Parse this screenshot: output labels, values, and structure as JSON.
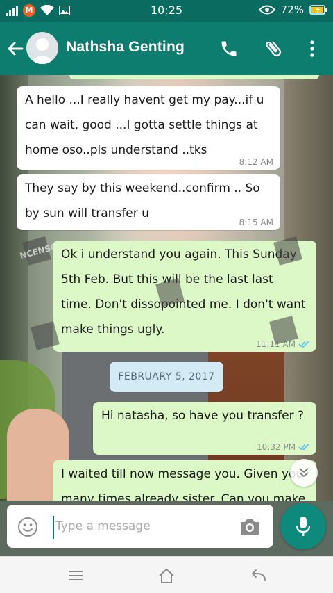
{
  "status_bar": {
    "time": "10:25",
    "battery": "72%",
    "carrier_badge": "M",
    "icons": [
      "signal-icon",
      "wifi-icon",
      "image-icon",
      "eye-icon",
      "battery-icon"
    ]
  },
  "header": {
    "contact_name": "Nathsha Genting",
    "icons": [
      "back-arrow-icon",
      "avatar-icon",
      "phone-icon",
      "paperclip-icon",
      "more-vert-icon"
    ],
    "color": "#0d7d70"
  },
  "messages": [
    {
      "direction": "in",
      "lines": [
        "A hello ...I really havent  get my pay...if u",
        "can wait, good ...I gotta settle things at",
        "home oso..pls understand ..tks"
      ],
      "time": "8:12 AM"
    },
    {
      "direction": "in",
      "lines": [
        "They say by this weekend..confirm .. So",
        "by sun will transfer u"
      ],
      "time": "8:15 AM"
    },
    {
      "direction": "out",
      "lines": [
        "Ok i understand you again. This Sunday",
        "5th Feb. But this will be the last last",
        "time. Don't dissopointed me. I don't want",
        "make things ugly."
      ],
      "time": "11:11 AM",
      "ticks": "read"
    },
    {
      "direction": "out",
      "lines": [
        "Hi natasha, so have you transfer ?"
      ],
      "time": "10:32 PM",
      "ticks": "read"
    },
    {
      "direction": "out",
      "lines": [
        "I waited till now message you. Given you",
        "many times already sister. Can you make"
      ]
    }
  ],
  "date_divider": "FEBRUARY 5, 2017",
  "watermark_text": "SG UNCENSORED",
  "input": {
    "placeholder": "Type a message"
  },
  "colors": {
    "incoming_bubble": "#ffffff",
    "outgoing_bubble": "#dcf8c6",
    "read_ticks": "#4fc3f7",
    "date_chip": "#d4eaf4",
    "mic_button": "#0d8a7b"
  }
}
